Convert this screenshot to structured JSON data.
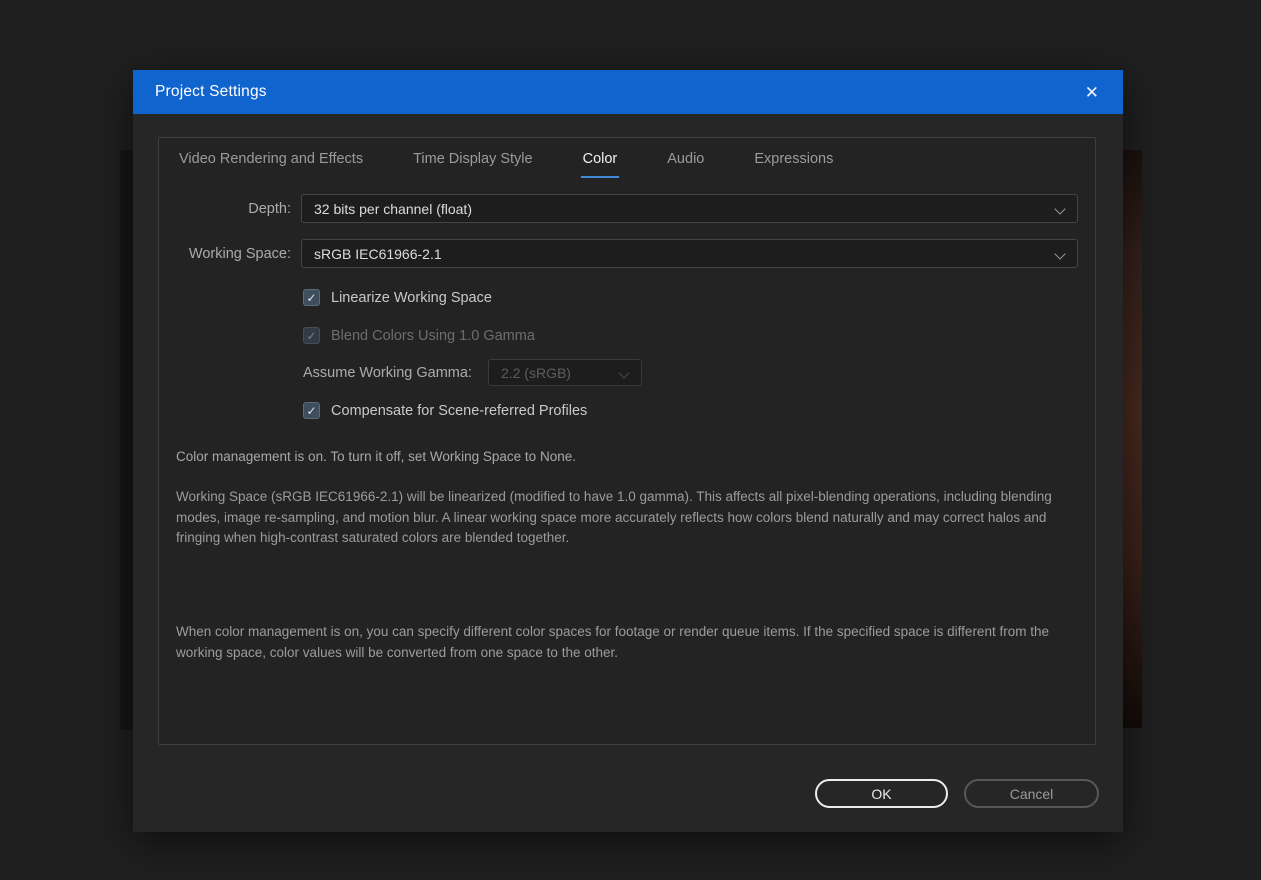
{
  "colors": {
    "titlebar": "#1064ce",
    "accent": "#4189d6",
    "page-bg": "#1f1f20"
  },
  "icons": {
    "close": "✕",
    "check": "✓"
  },
  "dialog": {
    "title": "Project Settings"
  },
  "tabs": [
    {
      "label": "Video Rendering and Effects",
      "active": false
    },
    {
      "label": "Time Display Style",
      "active": false
    },
    {
      "label": "Color",
      "active": true
    },
    {
      "label": "Audio",
      "active": false
    },
    {
      "label": "Expressions",
      "active": false
    }
  ],
  "fields": {
    "depth_label": "Depth:",
    "depth_value": "32 bits per channel (float)",
    "working_space_label": "Working Space:",
    "working_space_value": "sRGB IEC61966-2.1",
    "assume_gamma_label": "Assume Working Gamma:",
    "assume_gamma_value": "2.2 (sRGB)"
  },
  "checkboxes": [
    {
      "label": "Linearize Working Space",
      "checked": true,
      "disabled": false
    },
    {
      "label": "Blend Colors Using 1.0 Gamma",
      "checked": true,
      "disabled": true
    },
    {
      "label": "Compensate for Scene-referred Profiles",
      "checked": true,
      "disabled": false
    }
  ],
  "info": {
    "status_line": "Color management is on. To turn it off, set Working Space to None.",
    "paragraph1": "Working Space (sRGB IEC61966-2.1) will be linearized (modified to have 1.0 gamma). This affects all pixel-blending operations, including blending modes, image re-sampling, and motion blur. A linear working space more accurately reflects how colors blend naturally and may correct halos and fringing when high-contrast saturated colors are blended together.",
    "paragraph2": "When color management is on, you can specify different color spaces for footage or render queue items. If the specified space is different from the working space, color values will be converted from one space to the other."
  },
  "buttons": {
    "ok": "OK",
    "cancel": "Cancel"
  }
}
